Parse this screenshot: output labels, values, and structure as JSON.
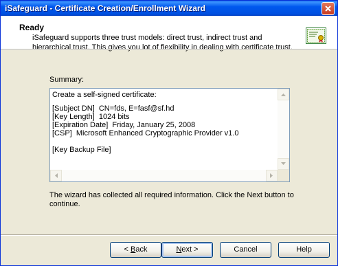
{
  "window": {
    "title": "iSafeguard - Certificate Creation/Enrollment Wizard"
  },
  "header": {
    "title": "Ready",
    "description": "iSafeguard supports three trust models: direct trust, indirect trust and hierarchical trust. This gives you lot of flexibility in dealing with certificate trust.",
    "icon": "certificate-icon"
  },
  "summary": {
    "label": "Summary:",
    "lines": [
      "Create a self-signed certificate:",
      "[Subject DN]  CN=fds, E=fasf@sf.hd",
      "[Key Length]  1024 bits",
      "[Expiration Date]  Friday, January 25, 2008",
      "[CSP]  Microsoft Enhanced Cryptographic Provider v1.0",
      "",
      "[Key Backup File]"
    ]
  },
  "info_text": "The wizard has collected all required information. Click the Next button to continue.",
  "buttons": {
    "back": {
      "prefix": "< ",
      "mnemonic": "B",
      "rest": "ack"
    },
    "next": {
      "mnemonic": "N",
      "rest": "ext >"
    },
    "cancel": "Cancel",
    "help": "Help"
  },
  "colors": {
    "titlebar": "#0054e3",
    "dialog_bg": "#ece9d8",
    "close_button": "#c5391f"
  }
}
